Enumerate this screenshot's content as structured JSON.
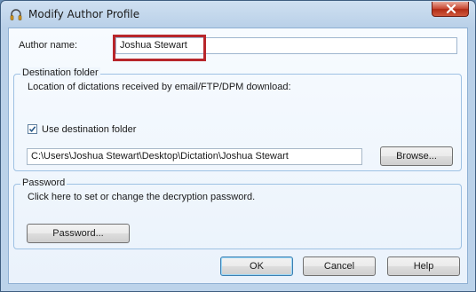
{
  "window": {
    "title": "Modify Author Profile"
  },
  "author": {
    "label": "Author name:",
    "value": "Joshua Stewart"
  },
  "destination": {
    "group_title": "Destination folder",
    "description": "Location of dictations received by email/FTP/DPM download:",
    "checkbox_label": "Use destination folder",
    "checkbox_checked": true,
    "path": "C:\\Users\\Joshua Stewart\\Desktop\\Dictation\\Joshua Stewart",
    "browse_label": "Browse..."
  },
  "password": {
    "group_title": "Password",
    "description": "Click here to set or change the decryption password.",
    "button_label": "Password..."
  },
  "footer": {
    "ok_label": "OK",
    "cancel_label": "Cancel",
    "help_label": "Help"
  },
  "icons": {
    "app": "headphones-icon",
    "close": "close-icon",
    "check": "checkmark-icon"
  },
  "colors": {
    "highlight": "#b8262b",
    "close_button": "#c7452f",
    "default_button_border": "#3c7fb1"
  }
}
